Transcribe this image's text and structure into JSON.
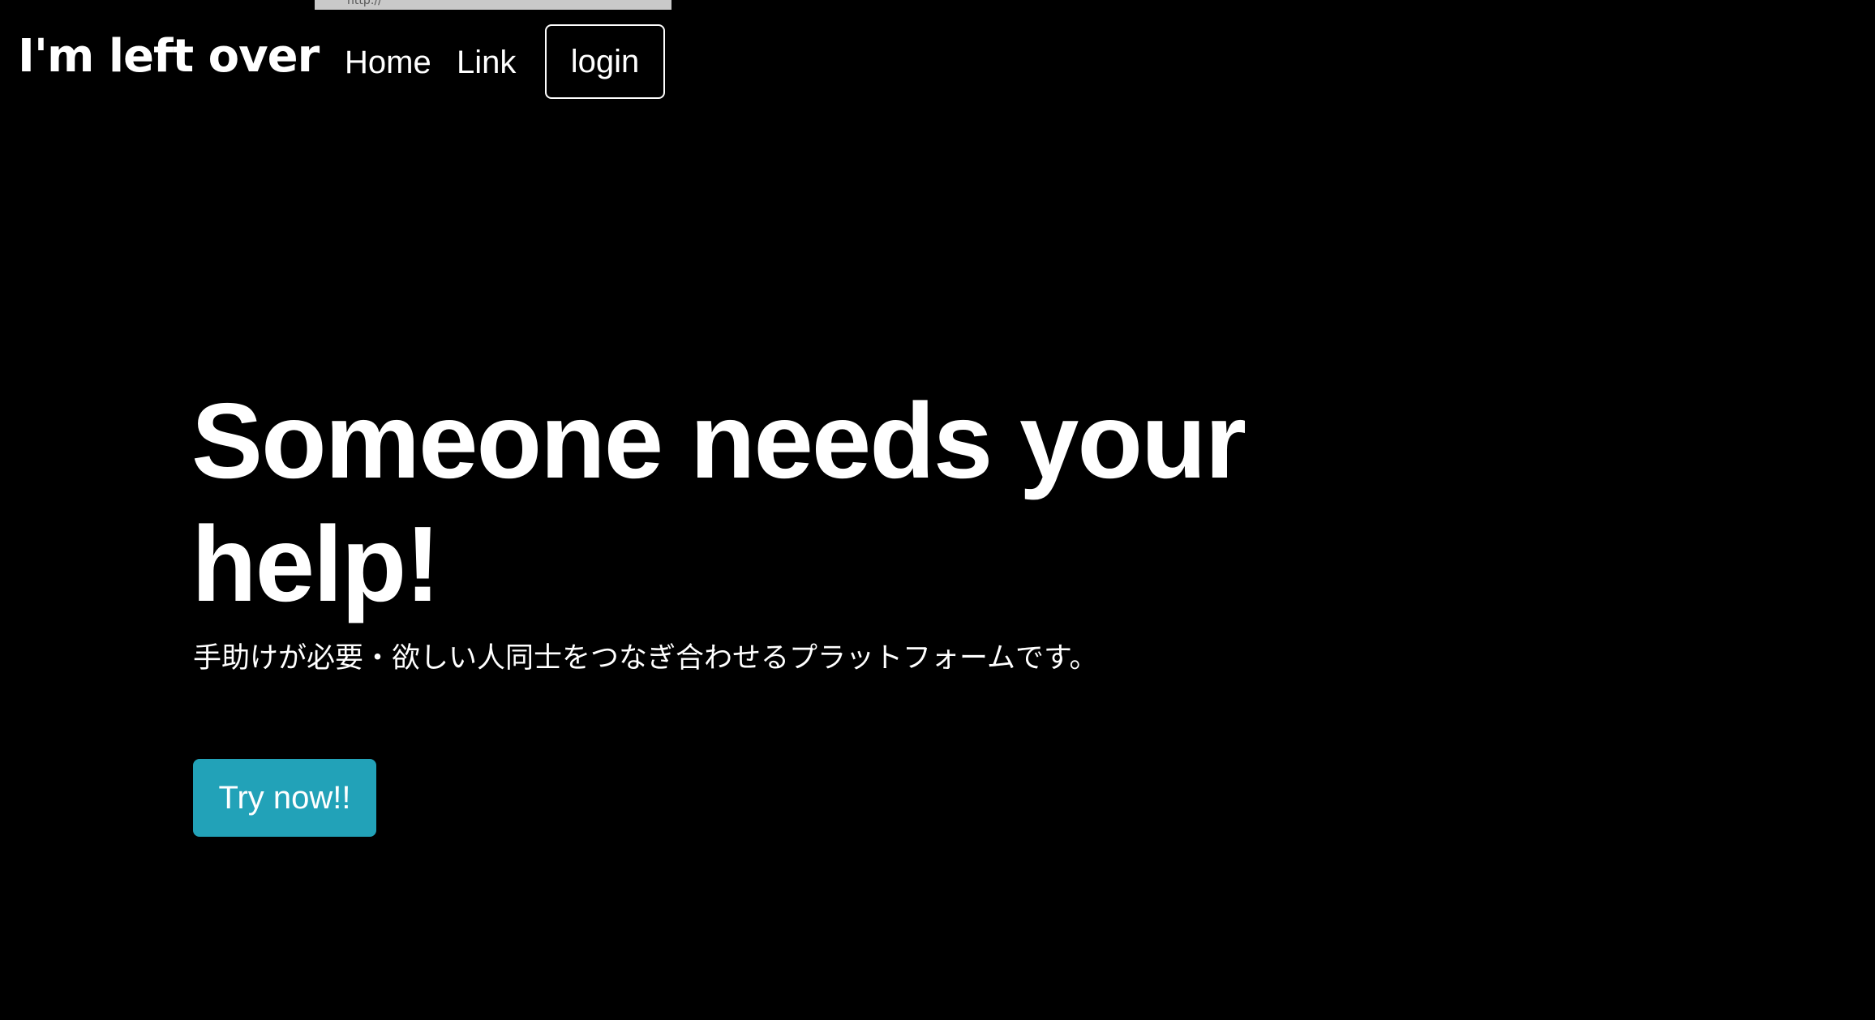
{
  "status_bar": {
    "url_text": "http://"
  },
  "navbar": {
    "brand": "I'm left over",
    "links": [
      {
        "label": "Home"
      },
      {
        "label": "Link"
      }
    ],
    "login_label": "login"
  },
  "hero": {
    "title": "Someone needs your help!",
    "subtitle": "手助けが必要・欲しい人同士をつなぎ合わせるプラットフォームです。",
    "cta_label": "Try now!!"
  },
  "colors": {
    "background": "#000000",
    "text": "#ffffff",
    "cta": "#22a2b8",
    "url_strip": "#c9c9c9"
  }
}
